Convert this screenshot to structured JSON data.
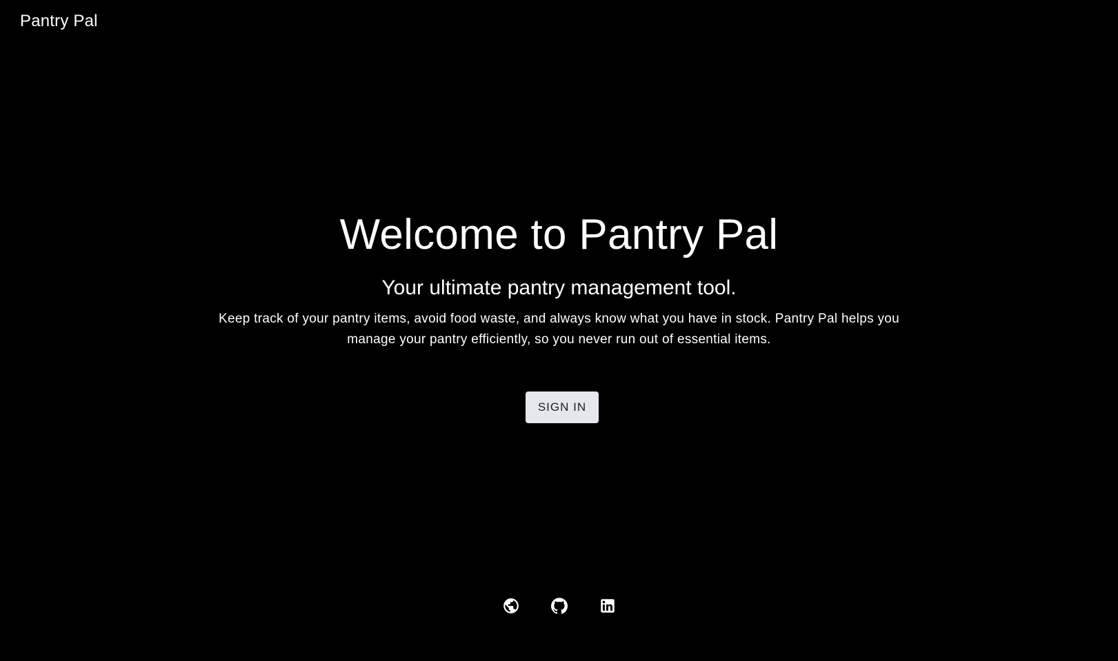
{
  "header": {
    "app_title": "Pantry Pal"
  },
  "hero": {
    "title": "Welcome to Pantry Pal",
    "subtitle": "Your ultimate pantry management tool.",
    "description": "Keep track of your pantry items, avoid food waste, and always know what you have in stock. Pantry Pal helps you manage your pantry efficiently, so you never run out of essential items.",
    "sign_in_label": "Sign In"
  },
  "footer": {
    "links": [
      {
        "icon": "globe-icon"
      },
      {
        "icon": "github-icon"
      },
      {
        "icon": "linkedin-icon"
      }
    ]
  },
  "colors": {
    "background": "#000000",
    "text": "#ffffff",
    "button_bg": "#e6e7ec",
    "button_text": "#1c1c24"
  }
}
